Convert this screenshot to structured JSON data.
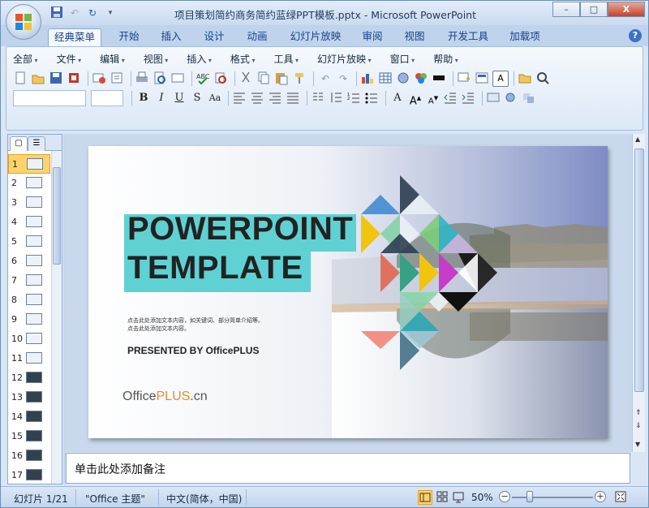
{
  "window": {
    "title": "项目策划简约商务简约蓝绿PPT模板.pptx - Microsoft PowerPoint",
    "buttons": [
      "–",
      "□",
      "X"
    ]
  },
  "ribbon_tabs": [
    "经典菜单",
    "开始",
    "插入",
    "设计",
    "动画",
    "幻灯片放映",
    "审阅",
    "视图",
    "开发工具",
    "加载项"
  ],
  "active_tab": "经典菜单",
  "classic_menu": [
    "全部",
    "文件",
    "编辑",
    "视图",
    "插入",
    "格式",
    "工具",
    "幻灯片放映",
    "窗口",
    "帮助"
  ],
  "toolbar": {
    "bold": "B",
    "italic": "I",
    "underline": "U",
    "shadow": "S",
    "case": "Aa",
    "font_color": "A"
  },
  "thumbnails": [
    "1",
    "2",
    "3",
    "4",
    "5",
    "6",
    "7",
    "8",
    "9",
    "10",
    "11",
    "12",
    "13",
    "14",
    "15",
    "16",
    "17"
  ],
  "selected_slide": "1",
  "slide": {
    "title_line1": "POWERPOINT",
    "title_line2": "TEMPLATE",
    "body_line1": "点击此处添加文本内容，如关键词、部分简单介绍等。",
    "body_line2": "点击此处添加文本内容。",
    "presented_by": "PRESENTED BY OfficePLUS",
    "logo_part1": "Office",
    "logo_part2": "PLUS",
    "logo_part3": ".cn",
    "accent_color": "#5fd1d3"
  },
  "notes_placeholder": "单击此处添加备注",
  "status": {
    "slide_info": "幻灯片 1/21",
    "theme": "\"Office 主题\"",
    "language": "中文(简体，中国)",
    "zoom": "50%"
  }
}
